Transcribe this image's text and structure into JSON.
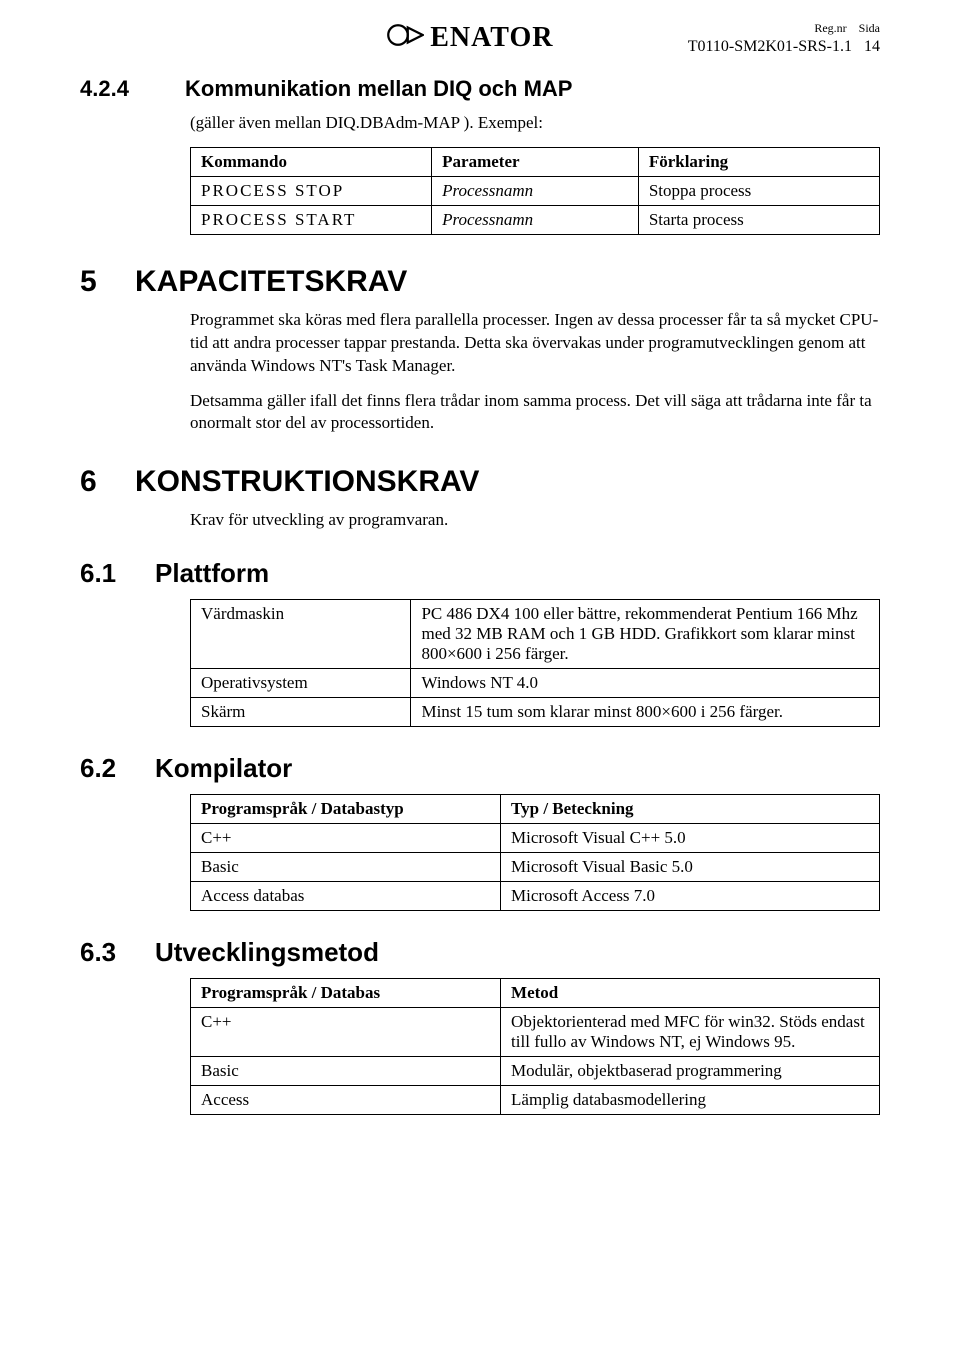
{
  "header": {
    "logo_text": "ENATOR",
    "reg_label": "Reg.nr",
    "sida_label": "Sida",
    "doc_id": "T0110-SM2K01-SRS-1.1",
    "page_no": "14"
  },
  "s424": {
    "num": "4.2.4",
    "title": "Kommunikation mellan DIQ och MAP",
    "sub": "(gäller även mellan DIQ.DBAdm-MAP ). Exempel:",
    "table": {
      "h1": "Kommando",
      "h2": "Parameter",
      "h3": "Förklaring",
      "r1c1": "PROCESS STOP",
      "r1c2": "Processnamn",
      "r1c3": "Stoppa process",
      "r2c1": "PROCESS START",
      "r2c2": "Processnamn",
      "r2c3": "Starta process"
    }
  },
  "s5": {
    "num": "5",
    "title": "KAPACITETSKRAV",
    "p1": "Programmet ska köras med flera parallella processer. Ingen av dessa processer får ta så mycket CPU-tid att andra processer tappar prestanda. Detta ska övervakas under programutvecklingen genom att använda  Windows NT's Task Manager.",
    "p2": "Detsamma gäller ifall det finns flera trådar inom samma process. Det vill säga att trådarna inte får ta onormalt stor del av processortiden."
  },
  "s6": {
    "num": "6",
    "title": "KONSTRUKTIONSKRAV",
    "p1": "Krav för utveckling av programvaran."
  },
  "s61": {
    "num": "6.1",
    "title": "Plattform",
    "table": {
      "r1c1": "Värdmaskin",
      "r1c2": "PC 486 DX4 100 eller bättre, rekommenderat Pentium 166 Mhz med 32 MB RAM och 1 GB HDD. Grafikkort som klarar minst 800×600 i 256 färger.",
      "r2c1": "Operativsystem",
      "r2c2": "Windows NT 4.0",
      "r3c1": "Skärm",
      "r3c2": "Minst 15 tum som klarar minst 800×600 i 256 färger."
    }
  },
  "s62": {
    "num": "6.2",
    "title": "Kompilator",
    "table": {
      "h1": "Programspråk / Databastyp",
      "h2": "Typ / Beteckning",
      "r1c1": "C++",
      "r1c2": "Microsoft Visual C++ 5.0",
      "r2c1": "Basic",
      "r2c2": "Microsoft Visual Basic 5.0",
      "r3c1": "Access databas",
      "r3c2": "Microsoft Access 7.0"
    }
  },
  "s63": {
    "num": "6.3",
    "title": "Utvecklingsmetod",
    "table": {
      "h1": "Programspråk / Databas",
      "h2": "Metod",
      "r1c1": "C++",
      "r1c2": "Objektorienterad med MFC för win32. Stöds endast till fullo av Windows NT, ej Windows 95.",
      "r2c1": "Basic",
      "r2c2": "Modulär, objektbaserad programmering",
      "r3c1": "Access",
      "r3c2": "Lämplig databasmodellering"
    }
  }
}
